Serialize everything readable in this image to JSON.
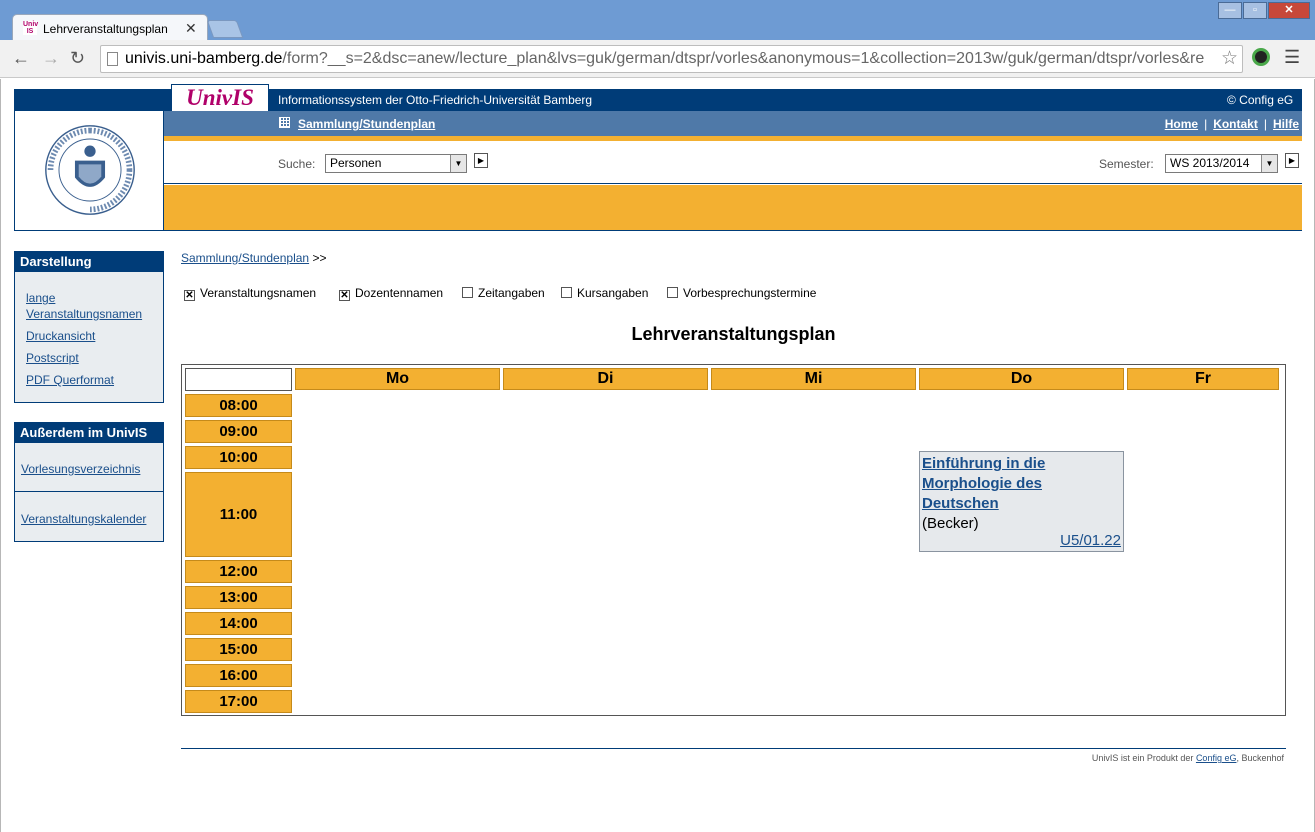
{
  "browser": {
    "tab_title": "Lehrveranstaltungsplan",
    "tab_favicon": "UnivIS",
    "url_host": "univis.uni-bamberg.de",
    "url_path": "/form?__s=2&dsc=anew/lecture_plan&lvs=guk/german/dtspr/vorles&anonymous=1&collection=2013w/guk/german/dtspr/vorles&re"
  },
  "header": {
    "logo": "UnivIS",
    "info": "Informationssystem der Otto-Friedrich-Universität Bamberg",
    "copyright": "© Config eG",
    "collection_link": "Sammlung/Stundenplan",
    "links": {
      "home": "Home",
      "contact": "Kontakt",
      "help": "Hilfe"
    },
    "search_label": "Suche:",
    "search_value": "Personen",
    "semester_label": "Semester:",
    "semester_value": "WS 2013/2014"
  },
  "sidebar": {
    "darstellung": {
      "title": "Darstellung",
      "links": [
        "lange",
        "Veranstaltungsnamen",
        "Druckansicht",
        "Postscript",
        "PDF Querformat"
      ]
    },
    "ausserdem": {
      "title": "Außerdem im UnivIS",
      "links": [
        "Vorlesungsverzeichnis",
        "Veranstaltungskalender"
      ]
    }
  },
  "main": {
    "breadcrumb_link": "Sammlung/Stundenplan",
    "breadcrumb_suffix": ">>",
    "options": [
      {
        "label": "Veranstaltungsnamen",
        "checked": true
      },
      {
        "label": "Dozentennamen",
        "checked": true
      },
      {
        "label": "Zeitangaben",
        "checked": false
      },
      {
        "label": "Kursangaben",
        "checked": false
      },
      {
        "label": "Vorbesprechungstermine",
        "checked": false
      }
    ],
    "title": "Lehrveranstaltungsplan",
    "days": [
      "Mo",
      "Di",
      "Mi",
      "Do",
      "Fr"
    ],
    "times": [
      "08:00",
      "09:00",
      "10:00",
      "11:00",
      "12:00",
      "13:00",
      "14:00",
      "15:00",
      "16:00",
      "17:00"
    ],
    "event": {
      "title_lines": [
        "Einführung in die",
        "Morphologie des",
        "Deutschen"
      ],
      "lecturer": "(Becker)",
      "room": "U5/01.22",
      "day": "Do"
    }
  },
  "footer": {
    "prefix": "UnivIS ist ein Produkt der",
    "link": "Config eG",
    "suffix": ", Buckenhof"
  }
}
